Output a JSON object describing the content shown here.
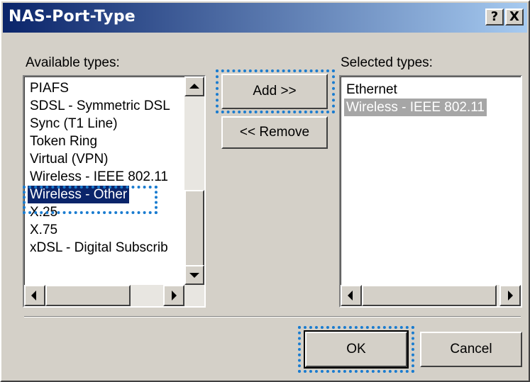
{
  "dialog": {
    "title": "NAS-Port-Type",
    "help_glyph": "?",
    "close_glyph": "X"
  },
  "available": {
    "label": "Available types:",
    "items": [
      "PIAFS",
      "SDSL - Symmetric DSL",
      "Sync (T1 Line)",
      "Token Ring",
      "Virtual (VPN)",
      "Wireless - IEEE 802.11",
      "Wireless - Other",
      "X.25",
      "X.75",
      "xDSL - Digital Subscrib"
    ],
    "selected": "Wireless - Other"
  },
  "selected_list": {
    "label": "Selected types:",
    "items": [
      "Ethernet",
      "Wireless - IEEE 802.11"
    ],
    "selected": "Wireless - IEEE 802.11"
  },
  "buttons": {
    "add": "Add >>",
    "remove": "<< Remove",
    "ok": "OK",
    "cancel": "Cancel"
  },
  "colors": {
    "title_bar_start": "#0a246a",
    "title_bar_end": "#a6caf0",
    "selection": "#0a246a",
    "inactive_selection": "#a6a6a6",
    "focus_highlight": "#1a7cd0",
    "dialog_face": "#d4d0c8"
  }
}
